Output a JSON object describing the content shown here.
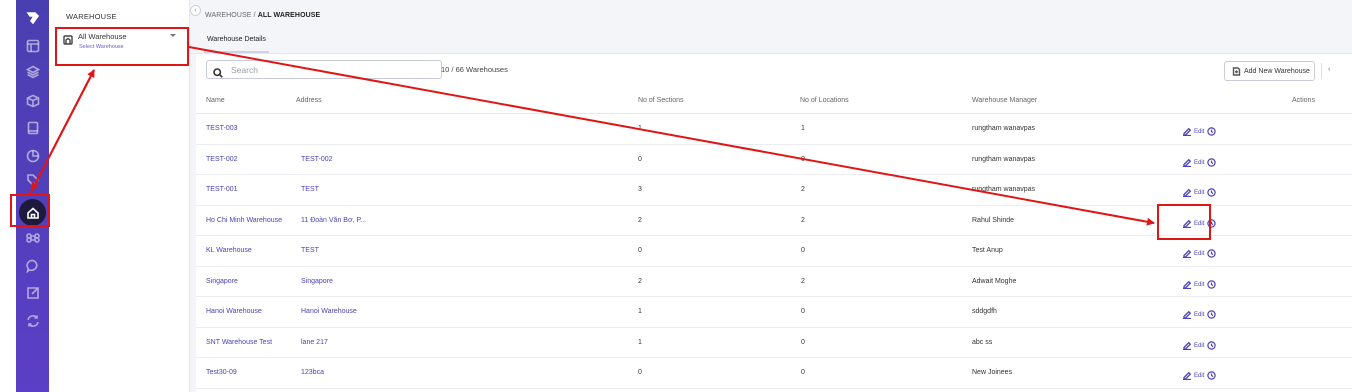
{
  "sidebar": {
    "icons": [
      "logo-icon",
      "layout-icon",
      "layers-icon",
      "box-icon",
      "book-icon",
      "pie-chart-icon",
      "tag-icon",
      "home-icon",
      "command-icon",
      "chat-icon",
      "export-icon",
      "sync-icon"
    ],
    "active": "home-icon"
  },
  "subnav": {
    "title": "WAREHOUSE",
    "selected": "All Warehouse",
    "hint": "Select Warehouse"
  },
  "breadcrumb": {
    "parent": "WAREHOUSE",
    "sep": " / ",
    "current": "ALL WAREHOUSE"
  },
  "tabs": [
    {
      "label": "Warehouse Details"
    }
  ],
  "toolbar": {
    "search_placeholder": "Search",
    "count": "10 / 66 Warehouses",
    "add_label": "Add New Warehouse",
    "more_label": "‹"
  },
  "table": {
    "headers": {
      "name": "Name",
      "address": "Address",
      "sections": "No of Sections",
      "locations": "No of Locations",
      "manager": "Warehouse Manager",
      "actions": "Actions"
    },
    "edit_label": "Edit",
    "rows": [
      {
        "name": "TEST-003",
        "address": "",
        "sections": "1",
        "locations": "1",
        "manager": "rungtham wanavpas"
      },
      {
        "name": "TEST-002",
        "address": "TEST-002",
        "sections": "0",
        "locations": "0",
        "manager": "rungtham wanavpas"
      },
      {
        "name": "TEST-001",
        "address": "TEST",
        "sections": "3",
        "locations": "2",
        "manager": "rungtham wanavpas"
      },
      {
        "name": "Ho Chi Minh Warehouse",
        "address": "11 Đoàn Văn Bơ, P...",
        "sections": "2",
        "locations": "2",
        "manager": "Rahul Shinde"
      },
      {
        "name": "KL Warehouse",
        "address": "TEST",
        "sections": "0",
        "locations": "0",
        "manager": "Test Anup"
      },
      {
        "name": "Singapore",
        "address": "Singapore",
        "sections": "2",
        "locations": "2",
        "manager": "Adwait Moghe"
      },
      {
        "name": "Hanoi Warehouse",
        "address": "Hanoi Warehouse",
        "sections": "1",
        "locations": "0",
        "manager": "sddgdfh"
      },
      {
        "name": "SNT Warehouse Test",
        "address": "lane 217",
        "sections": "1",
        "locations": "0",
        "manager": "abc ss"
      },
      {
        "name": "Test30-09",
        "address": "123bca",
        "sections": "0",
        "locations": "0",
        "manager": "New Joinees"
      }
    ]
  },
  "annotation_color": "#e01515"
}
